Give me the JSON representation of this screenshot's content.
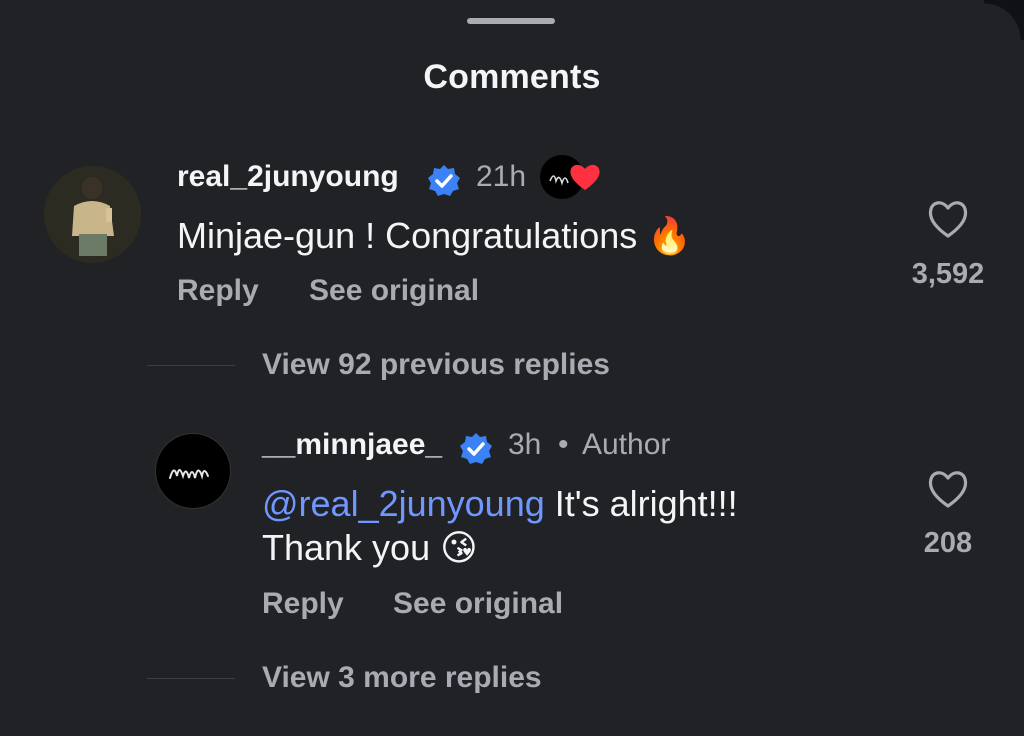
{
  "sheet": {
    "title": "Comments"
  },
  "comments": [
    {
      "username": "real_2junyoung",
      "verified": true,
      "time": "21h",
      "text": "Minjae-gun ! Congratulations",
      "emoji": "🔥",
      "reply_label": "Reply",
      "see_original_label": "See original",
      "like_count": "3,592",
      "view_replies_label": "View 92 previous replies"
    },
    {
      "username": "__minnjaee_",
      "verified": true,
      "time": "3h",
      "separator": "•",
      "author_label": "Author",
      "mention": "@real_2junyoung",
      "text_line1": " It's alright!!!",
      "text_line2": "Thank you",
      "emoji": "😘",
      "reply_label": "Reply",
      "see_original_label": "See original",
      "like_count": "208",
      "view_replies_label": "View 3 more replies"
    }
  ],
  "colors": {
    "background": "#202226",
    "text_primary": "#f3f5f7",
    "text_secondary": "#a8acb2",
    "verified_blue": "#3b82f6",
    "mention_blue": "#6f97ff",
    "heart_red": "#ff3040"
  },
  "icons": {
    "verified": "verified-badge-icon",
    "like": "heart-outline-icon",
    "mention": "threads-at-icon",
    "creator_heart": "red-heart-icon"
  }
}
